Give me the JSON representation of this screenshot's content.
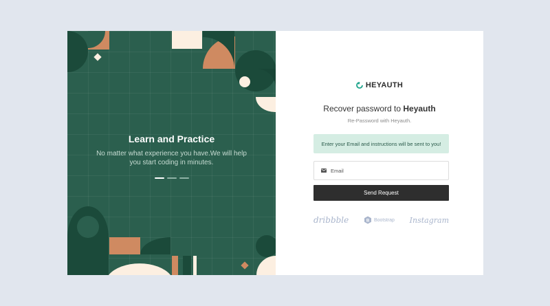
{
  "slider": {
    "title": "Learn and Practice",
    "description": "No matter what experience you have.We will help you start coding in minutes.",
    "active_slide": 1,
    "slide_count": 3
  },
  "logo": {
    "text": "HEYAUTH"
  },
  "form": {
    "heading_prefix": "Recover password to ",
    "heading_brand": "Heyauth",
    "subheading": "Re-Password with Heyauth.",
    "alert": "Enter your Email and instructions will be sent to you!",
    "email_placeholder": "Email",
    "email_value": "",
    "submit_label": "Send Request"
  },
  "brands": [
    "dribbble",
    "Bootstrap",
    "Instagram"
  ],
  "colors": {
    "panel_green": "#2b5f4e",
    "dark_green": "#1b4a3a",
    "peach": "#cf8a61",
    "cream": "#fcefe1",
    "button_dark": "#2e2e2e",
    "alert_bg": "#d5ede3",
    "logo_accent": "#1aa38a"
  }
}
